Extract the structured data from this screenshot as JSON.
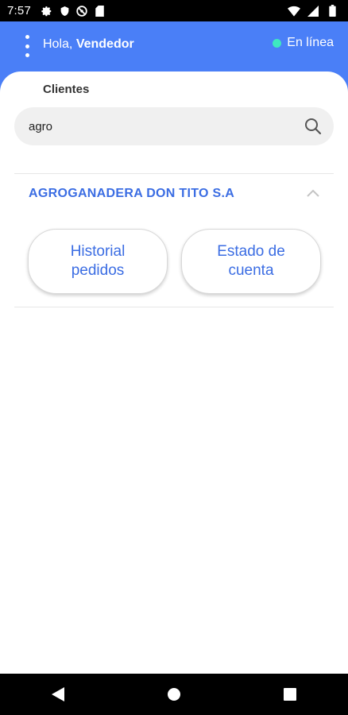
{
  "status_bar": {
    "time": "7:57",
    "left_icons": [
      "settings-icon",
      "shield-icon",
      "do-not-disturb-icon",
      "sim-card-icon"
    ],
    "right_icons": [
      "wifi-icon",
      "signal-icon",
      "battery-icon"
    ]
  },
  "header": {
    "greeting_prefix": "Hola,",
    "user_name": "Vendedor",
    "status_label": "En línea",
    "status_color": "#3ee8c0",
    "background_color": "#4a7ff7"
  },
  "clients": {
    "section_label": "Clientes",
    "search_value": "agro",
    "results": [
      {
        "name": "AGROGANADERA DON TITO S.A",
        "expanded": true,
        "actions": [
          {
            "label": "Historial pedidos"
          },
          {
            "label": "Estado de cuenta"
          }
        ]
      }
    ]
  },
  "accent_color": "#3b6de3"
}
